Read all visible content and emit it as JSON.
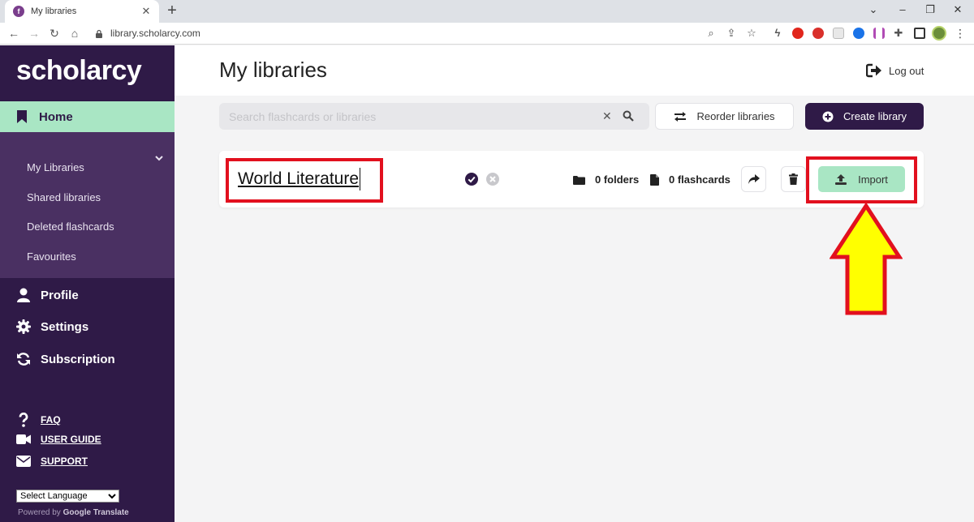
{
  "browser": {
    "tab_title": "My libraries",
    "tab_favicon_letter": "f",
    "url": "library.scholarcy.com"
  },
  "sidebar": {
    "logo": "scholarcy",
    "home_label": "Home",
    "submenu": [
      "My Libraries",
      "Shared libraries",
      "Deleted flashcards",
      "Favourites"
    ],
    "main_items": [
      "Profile",
      "Settings",
      "Subscription"
    ],
    "help_links": [
      "FAQ",
      "USER GUIDE",
      "SUPPORT"
    ],
    "language_select": "Select Language",
    "powered_prefix": "Powered by",
    "powered_google": "Google",
    "powered_translate": "Translate"
  },
  "header": {
    "title": "My libraries",
    "logout_label": "Log out"
  },
  "toolbar": {
    "search_placeholder": "Search flashcards or libraries",
    "reorder_label": "Reorder libraries",
    "create_label": "Create library"
  },
  "library": {
    "name": "World Literature",
    "folders": "0 folders",
    "flashcards": "0 flashcards",
    "import_label": "Import"
  },
  "colors": {
    "brand_purple": "#2f1a47",
    "submenu_purple": "#4a3062",
    "accent_green": "#a9e6c4",
    "highlight_red": "#e2101e",
    "arrow_yellow": "#ffff00"
  }
}
